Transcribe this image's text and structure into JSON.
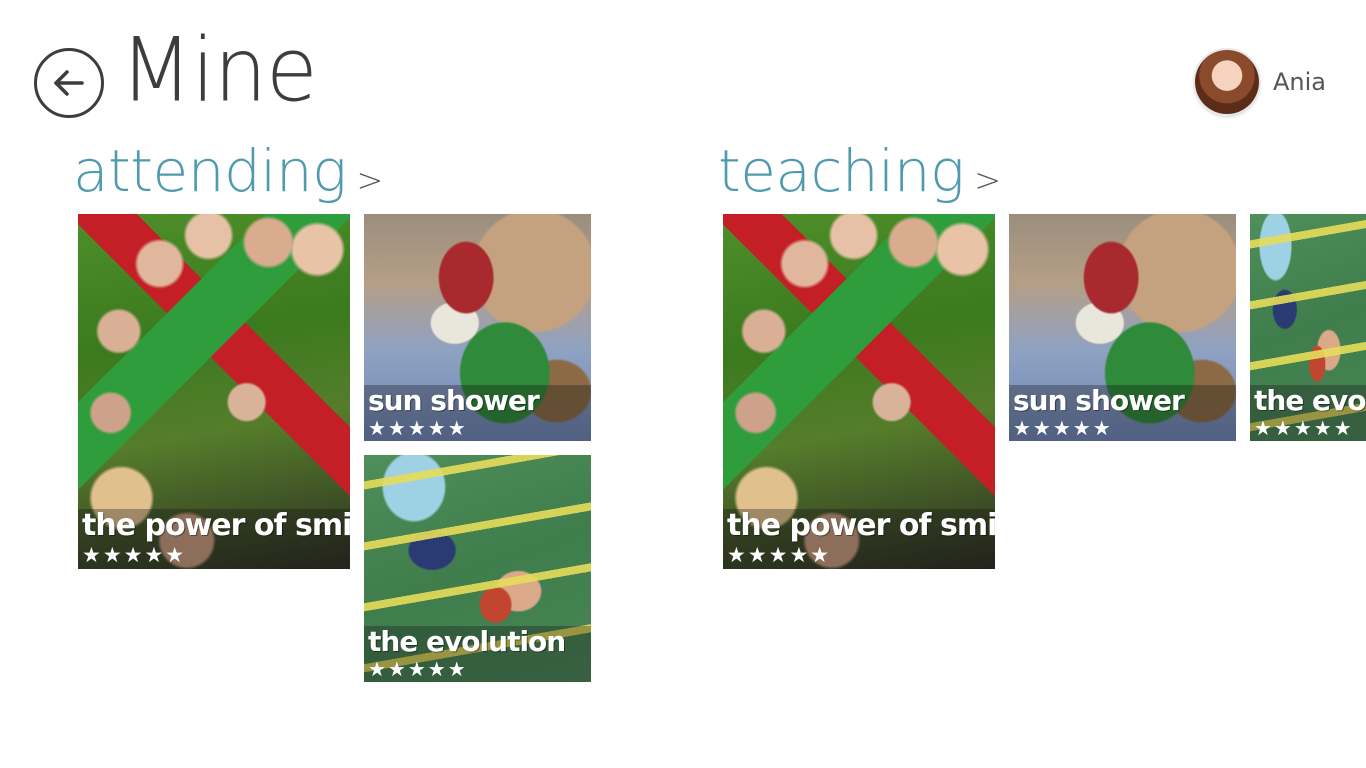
{
  "header": {
    "title": "Mine",
    "back_icon": "back-arrow-icon",
    "user": {
      "name": "Ania"
    }
  },
  "sections": [
    {
      "title": "attending",
      "chevron": ">",
      "tiles": [
        {
          "title": "the power of smile",
          "stars": "★★★★★"
        },
        {
          "title": "sun shower",
          "stars": "★★★★★"
        },
        {
          "title": "the evolution",
          "stars": "★★★★★"
        }
      ]
    },
    {
      "title": "teaching",
      "chevron": ">",
      "tiles": [
        {
          "title": "the power of smile",
          "stars": "★★★★★"
        },
        {
          "title": "sun shower",
          "stars": "★★★★★"
        },
        {
          "title": "the evol",
          "stars": "★★★★★"
        }
      ]
    }
  ]
}
